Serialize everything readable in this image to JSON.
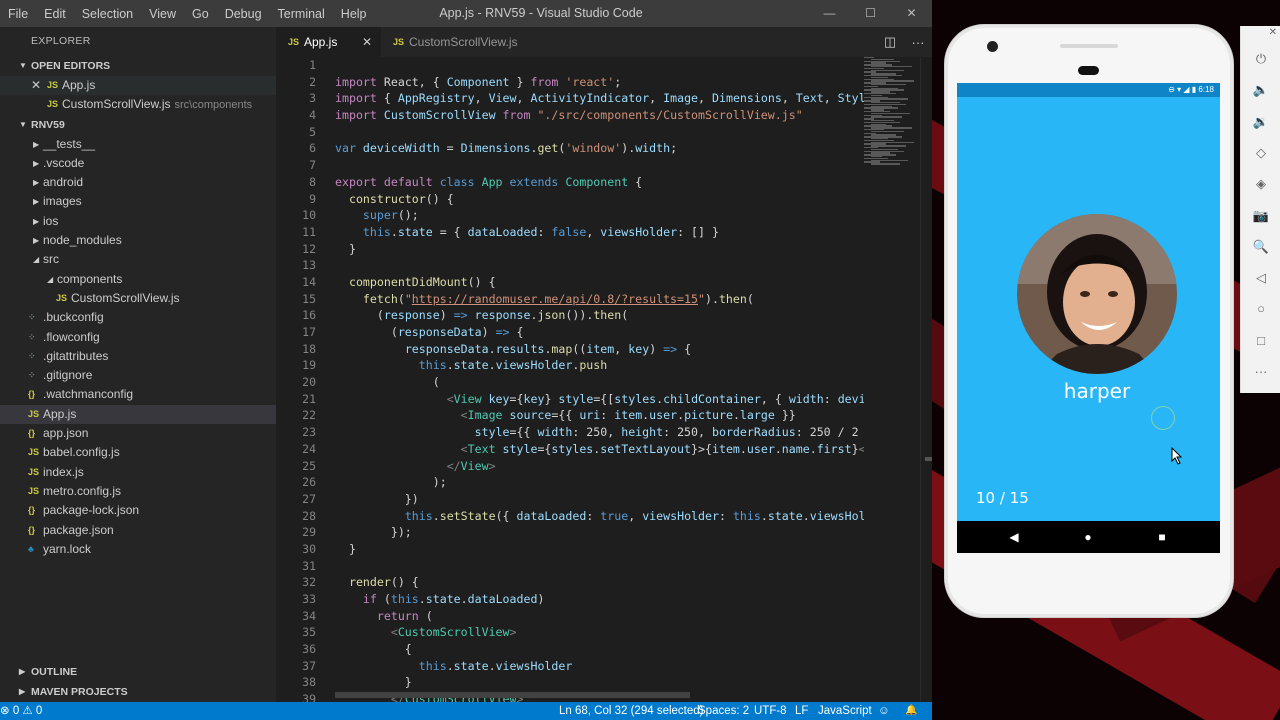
{
  "window": {
    "title": "App.js - RNV59 - Visual Studio Code",
    "menu": [
      "File",
      "Edit",
      "Selection",
      "View",
      "Go",
      "Debug",
      "Terminal",
      "Help"
    ],
    "controls": [
      "—",
      "☐",
      "✕"
    ]
  },
  "sidebar": {
    "explorer_label": "EXPLORER",
    "open_editors_label": "OPEN EDITORS",
    "open_editors": [
      {
        "icon": "JS",
        "name": "App.js",
        "path": ""
      },
      {
        "icon": "JS",
        "name": "CustomScrollView.js",
        "path": "src\\components"
      }
    ],
    "project_label": "RNV59",
    "tree": [
      {
        "name": "__tests__",
        "kind": "folder"
      },
      {
        "name": ".vscode",
        "kind": "folder"
      },
      {
        "name": "android",
        "kind": "folder"
      },
      {
        "name": "images",
        "kind": "folder"
      },
      {
        "name": "ios",
        "kind": "folder"
      },
      {
        "name": "node_modules",
        "kind": "folder"
      },
      {
        "name": "src",
        "kind": "folder-open"
      },
      {
        "name": "components",
        "kind": "folder-open"
      },
      {
        "name": "CustomScrollView.js",
        "kind": "js"
      },
      {
        "name": ".buckconfig",
        "kind": "dot"
      },
      {
        "name": ".flowconfig",
        "kind": "dot"
      },
      {
        "name": ".gitattributes",
        "kind": "dot"
      },
      {
        "name": ".gitignore",
        "kind": "dot"
      },
      {
        "name": ".watchmanconfig",
        "kind": "json"
      },
      {
        "name": "App.js",
        "kind": "js"
      },
      {
        "name": "app.json",
        "kind": "json"
      },
      {
        "name": "babel.config.js",
        "kind": "js"
      },
      {
        "name": "index.js",
        "kind": "js"
      },
      {
        "name": "metro.config.js",
        "kind": "js"
      },
      {
        "name": "package-lock.json",
        "kind": "json"
      },
      {
        "name": "package.json",
        "kind": "json"
      },
      {
        "name": "yarn.lock",
        "kind": "yarn"
      }
    ],
    "outline_label": "OUTLINE",
    "maven_label": "MAVEN PROJECTS"
  },
  "tabs": [
    {
      "icon": "JS",
      "label": "App.js",
      "close": "✕"
    },
    {
      "icon": "JS",
      "label": "CustomScrollView.js"
    }
  ],
  "code": {
    "line_numbers": [
      "1",
      "2",
      "3",
      "4",
      "5",
      "6",
      "7",
      "8",
      "9",
      "10",
      "11",
      "12",
      "13",
      "14",
      "15",
      "16",
      "17",
      "18",
      "19",
      "20",
      "21",
      "22",
      "23",
      "24",
      "25",
      "26",
      "27",
      "28",
      "29",
      "30",
      "31",
      "32",
      "33",
      "34",
      "35",
      "36",
      "37",
      "38",
      "39"
    ]
  },
  "status": {
    "errors": "⊗ 0  ⚠ 0",
    "position": "Ln 68, Col 32 (294 selected)",
    "spaces": "Spaces: 2",
    "encoding": "UTF-8",
    "eol": "LF",
    "language": "JavaScript",
    "feedback": "☺",
    "bell": "🔔"
  },
  "phone": {
    "time": "6:18",
    "status_icons": "⊖ ▾ ◢ ▮",
    "name": "harper",
    "counter": "10 / 15",
    "nav": [
      "◀",
      "●",
      "■"
    ]
  },
  "tools": [
    "⏻",
    "🔈",
    "🔉",
    "◇",
    "◈",
    "📷",
    "🔍",
    "◁",
    "○",
    "□",
    "···"
  ]
}
